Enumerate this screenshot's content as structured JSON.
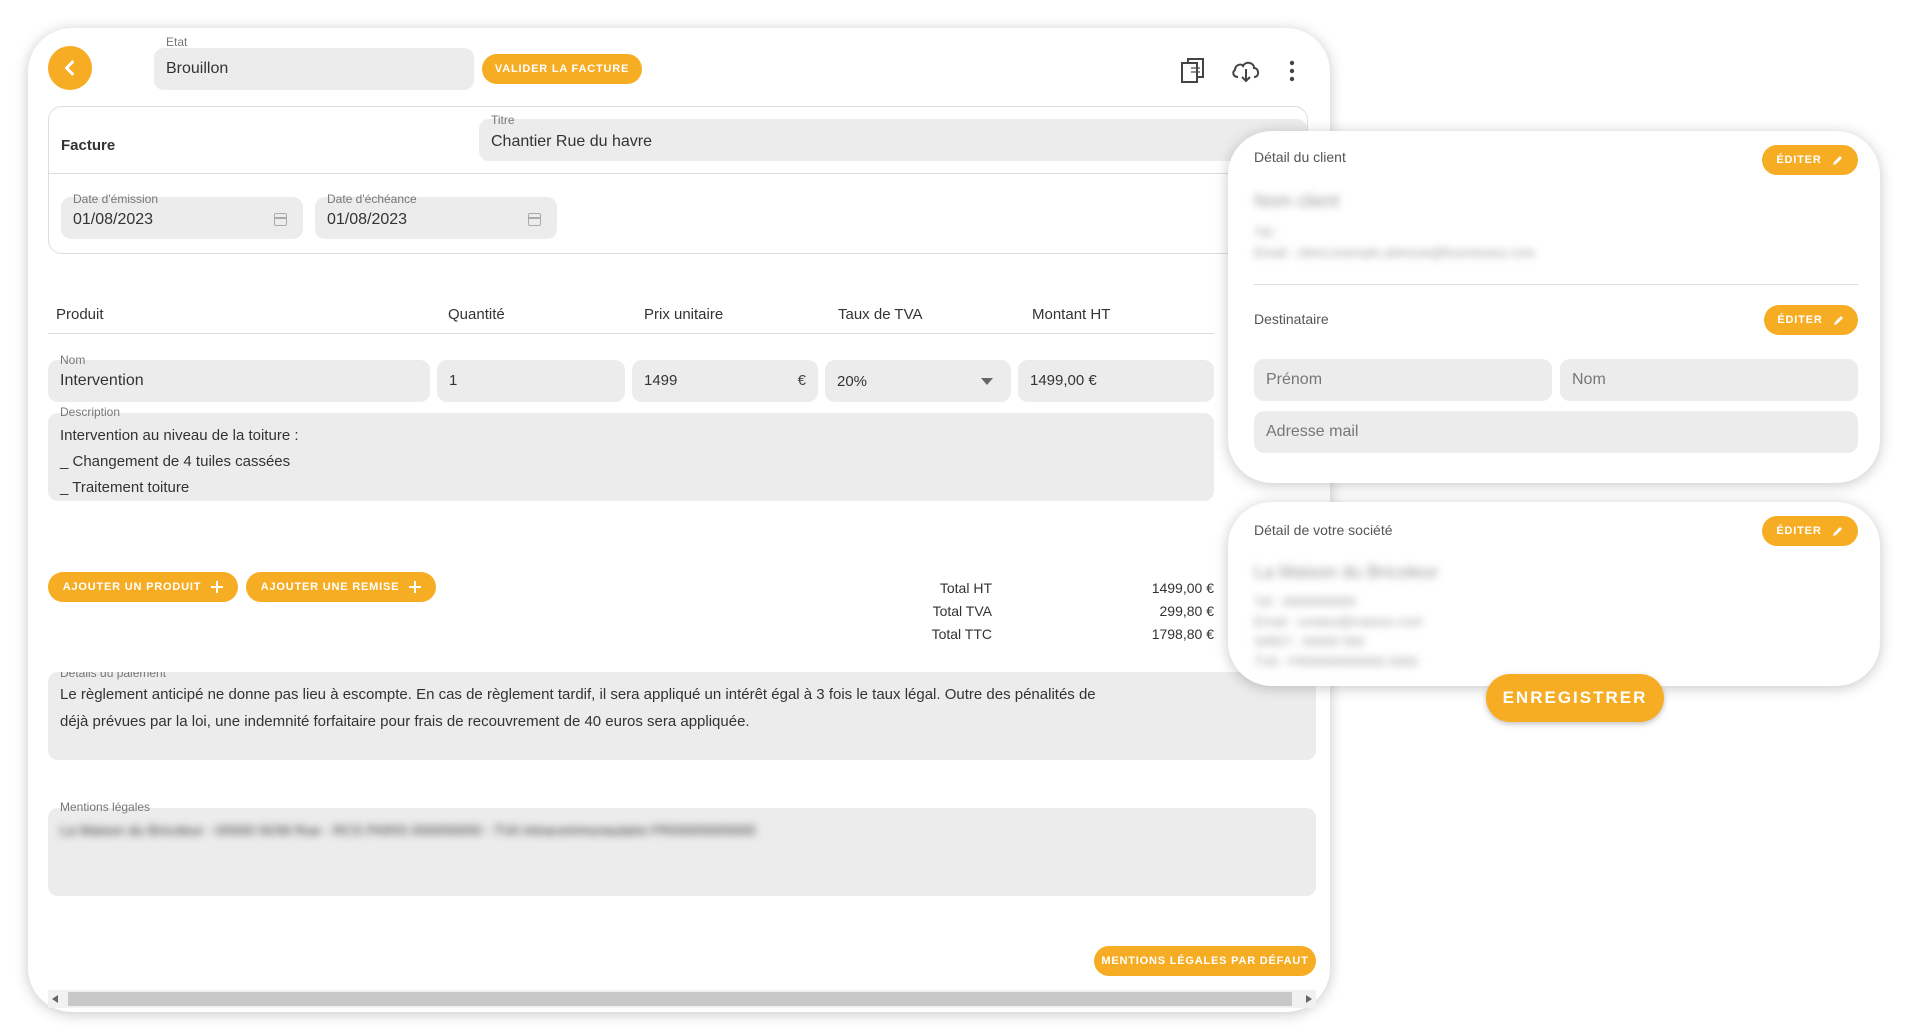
{
  "header": {
    "etat_label": "Etat",
    "etat_value": "Brouillon",
    "validate_button": "VALIDER LA FACTURE",
    "icons": [
      "back-icon",
      "copy-icon",
      "cloud-download-icon",
      "more-vert-icon"
    ]
  },
  "invoice": {
    "type_label": "Facture",
    "title_label": "Titre",
    "title_value": "Chantier Rue du havre",
    "issue_date_label": "Date d'émission",
    "issue_date_value": "01/08/2023",
    "due_date_label": "Date d'échéance",
    "due_date_value": "01/08/2023"
  },
  "table": {
    "headers": [
      "Produit",
      "Quantité",
      "Prix unitaire",
      "Taux de TVA",
      "Montant HT"
    ],
    "row": {
      "name_label": "Nom",
      "name_value": "Intervention",
      "quantity": "1",
      "unit_price": "1499",
      "currency": "€",
      "vat": "20%",
      "amount": "1499,00 €",
      "description_label": "Description",
      "description_lines": [
        "Intervention au niveau de la toiture :",
        "_ Changement de 4 tuiles cassées",
        "_ Traitement toiture"
      ]
    }
  },
  "actions": {
    "add_product": "AJOUTER UN PRODUIT",
    "add_discount": "AJOUTER UNE REMISE"
  },
  "totals": {
    "ht_label": "Total HT",
    "ht_value": "1499,00 €",
    "tva_label": "Total TVA",
    "tva_value": "299,80 €",
    "ttc_label": "Total TTC",
    "ttc_value": "1798,80 €"
  },
  "payment": {
    "label": "Détails du paiement",
    "line1": "Le règlement anticipé ne donne pas lieu à escompte. En cas de règlement tardif, il sera appliqué un intérêt égal à 3 fois le taux légal. Outre des pénalités de",
    "line2": "déjà prévues par la loi, une indemnité forfaitaire pour frais de recouvrement de 40 euros sera appliquée."
  },
  "legal": {
    "label": "Mentions légales",
    "blurred_text": "La Maison du Bricoleur - 00000 NOM Rue - RCS PARIS 000000000 - TVA Intracommunautaire FR00000000000",
    "default_button": "MENTIONS LÉGALES PAR DÉFAUT"
  },
  "client_panel": {
    "title": "Détail du client",
    "edit_button": "ÉDITER",
    "blurred_name": "Nom client",
    "blurred_line1": "Tél :",
    "blurred_line2": "Email : client.exemple.adresse@fournisseur.com",
    "recipient_title": "Destinataire",
    "recipient_edit": "ÉDITER",
    "firstname_placeholder": "Prénom",
    "lastname_placeholder": "Nom",
    "email_placeholder": "Adresse mail"
  },
  "company_panel": {
    "title": "Détail de votre société",
    "edit_button": "ÉDITER",
    "blurred_name": "La Maison du Bricoleur",
    "blurred_line1": "Tél : 0000000000",
    "blurred_line2": "Email : contact@maison.com",
    "blurred_line3": "SIRET : 00000 000",
    "blurred_line4": "TVA : FR00000000000 0000"
  },
  "save_button": "ENREGISTRER",
  "colors": {
    "accent": "#f6ad24",
    "field_bg": "#ececec",
    "card_bg": "#ffffff"
  }
}
